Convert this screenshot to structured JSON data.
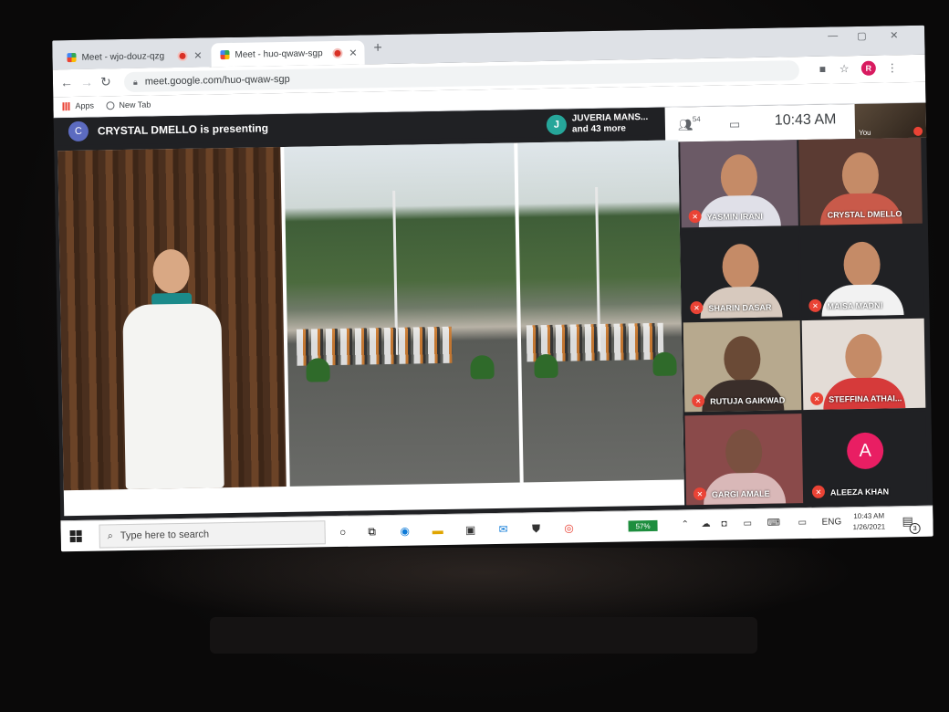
{
  "browser": {
    "tabs": [
      {
        "title": "Meet - wjo-douz-qzg"
      },
      {
        "title": "Meet - huo-qwaw-sgp"
      }
    ],
    "new_tab_symbol": "+",
    "window_controls": {
      "minimize": "—",
      "maximize": "▢",
      "close": "✕"
    },
    "url": "meet.google.com/huo-qwaw-sgp",
    "profile_initial": "R",
    "bookmarks": [
      {
        "label": "Apps",
        "icon": "apps-grid-icon"
      },
      {
        "label": "New Tab",
        "icon": "globe-icon"
      }
    ]
  },
  "meet": {
    "presenter": {
      "initial": "C",
      "text": "CRYSTAL DMELLO is presenting"
    },
    "joined_notice": {
      "initial": "J",
      "line1": "JUVERIA MANS...",
      "line2": "and 43 more"
    },
    "participant_count": "54",
    "time": "10:43 AM",
    "self_label": "You",
    "participants": [
      {
        "name": "YASMIN IRANI",
        "muted": true
      },
      {
        "name": "CRYSTAL DMELLO",
        "muted": false
      },
      {
        "name": "SHARIN DASAR",
        "muted": true
      },
      {
        "name": "MAISA MADNI",
        "muted": true
      },
      {
        "name": "RUTUJA GAIKWAD",
        "muted": true
      },
      {
        "name": "STEFFINA ATHAI...",
        "muted": true
      },
      {
        "name": "GARGI AMALE",
        "muted": true
      },
      {
        "name": "ALEEZA KHAN",
        "muted": true,
        "avatar_letter": "A"
      }
    ]
  },
  "taskbar": {
    "search_placeholder": "Type here to search",
    "battery": "57%",
    "language": "ENG",
    "time": "10:43 AM",
    "date": "1/26/2021",
    "notification_count": "3"
  },
  "colors": {
    "meet_bg": "#202124",
    "mute_red": "#ea4335",
    "battery_green": "#1e8e3e",
    "avatar_pink": "#e91e63"
  }
}
